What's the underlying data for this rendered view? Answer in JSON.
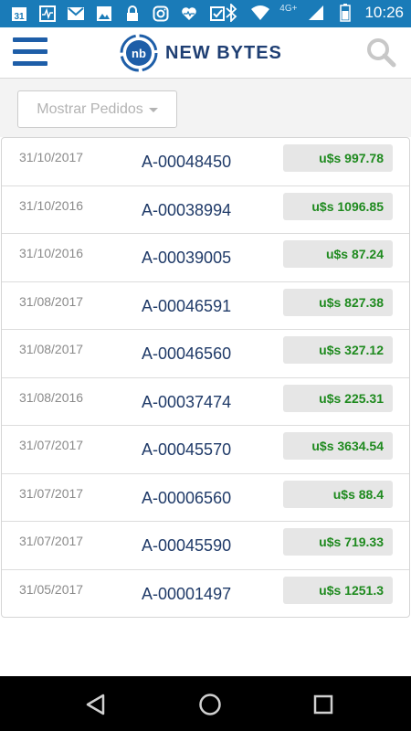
{
  "status_bar": {
    "time": "10:26",
    "network": "4G+",
    "calendar_day": "31",
    "icons": [
      "calendar-icon",
      "pulse-icon",
      "gmail-icon",
      "image-icon",
      "lock-icon",
      "instagram-icon",
      "heart-pulse-icon",
      "tasks-icon",
      "bluetooth-icon",
      "wifi-icon",
      "signal-icon",
      "battery-icon"
    ]
  },
  "header": {
    "logo_mark": "nb",
    "logo_text": "NEW BYTES",
    "menu_icon": "hamburger-menu-icon",
    "search_icon": "search-icon"
  },
  "filter": {
    "label": "Mostrar Pedidos"
  },
  "orders": [
    {
      "date": "31/10/2017",
      "id": "A-00048450",
      "amount": "u$s 997.78"
    },
    {
      "date": "31/10/2016",
      "id": "A-00038994",
      "amount": "u$s 1096.85"
    },
    {
      "date": "31/10/2016",
      "id": "A-00039005",
      "amount": "u$s 87.24"
    },
    {
      "date": "31/08/2017",
      "id": "A-00046591",
      "amount": "u$s 827.38"
    },
    {
      "date": "31/08/2017",
      "id": "A-00046560",
      "amount": "u$s 327.12"
    },
    {
      "date": "31/08/2016",
      "id": "A-00037474",
      "amount": "u$s 225.31"
    },
    {
      "date": "31/07/2017",
      "id": "A-00045570",
      "amount": "u$s 3634.54"
    },
    {
      "date": "31/07/2017",
      "id": "A-00006560",
      "amount": "u$s 88.4"
    },
    {
      "date": "31/07/2017",
      "id": "A-00045590",
      "amount": "u$s 719.33"
    },
    {
      "date": "31/05/2017",
      "id": "A-00001497",
      "amount": "u$s 1251.3"
    }
  ],
  "colors": {
    "status_bar": "#1a7bb8",
    "brand_blue": "#1e5ea8",
    "amount_green": "#1e8a1e"
  },
  "nav": {
    "back_icon": "back-triangle-icon",
    "home_icon": "home-circle-icon",
    "recents_icon": "recents-square-icon"
  }
}
